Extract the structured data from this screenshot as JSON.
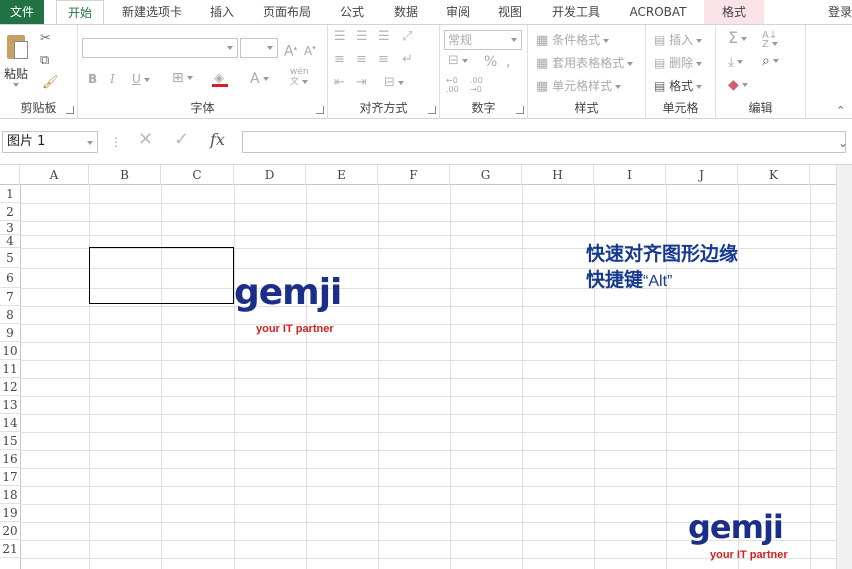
{
  "tabs": [
    {
      "label": "文件"
    },
    {
      "label": "开始"
    },
    {
      "label": "新建选项卡"
    },
    {
      "label": "插入"
    },
    {
      "label": "页面布局"
    },
    {
      "label": "公式"
    },
    {
      "label": "数据"
    },
    {
      "label": "审阅"
    },
    {
      "label": "视图"
    },
    {
      "label": "开发工具"
    },
    {
      "label": "ACROBAT"
    },
    {
      "label": "格式"
    }
  ],
  "signin": "登录",
  "ribbon": {
    "clipboard": {
      "label": "剪贴板",
      "paste": "粘贴"
    },
    "font": {
      "label": "字体"
    },
    "alignment": {
      "label": "对齐方式"
    },
    "number": {
      "label": "数字",
      "format": "常规"
    },
    "styles": {
      "label": "样式",
      "conditional": "条件格式",
      "table": "套用表格格式",
      "cell": "单元格样式"
    },
    "cells": {
      "label": "单元格",
      "insert": "插入",
      "delete": "删除",
      "format": "格式"
    },
    "editing": {
      "label": "编辑"
    }
  },
  "formula_bar": {
    "name_box": "图片 1",
    "fx": "fx"
  },
  "columns": [
    "A",
    "B",
    "C",
    "D",
    "E",
    "F",
    "G",
    "H",
    "I",
    "J",
    "K"
  ],
  "rows": [
    "1",
    "2",
    "3",
    "4",
    "5",
    "6",
    "7",
    "8",
    "9",
    "10",
    "11",
    "12",
    "13",
    "14",
    "15",
    "16",
    "17",
    "18",
    "19",
    "20",
    "21"
  ],
  "note": {
    "line1": "快速对齐图形边缘",
    "line2_prefix": "快捷键",
    "line2_key": "“Alt”"
  },
  "logo": {
    "word": "gemji",
    "tagline": "your IT partner"
  },
  "colors": {
    "excel_green": "#217346",
    "logo_blue": "#1b2f88",
    "logo_red": "#d81e1e",
    "note_blue": "#163a8f"
  }
}
